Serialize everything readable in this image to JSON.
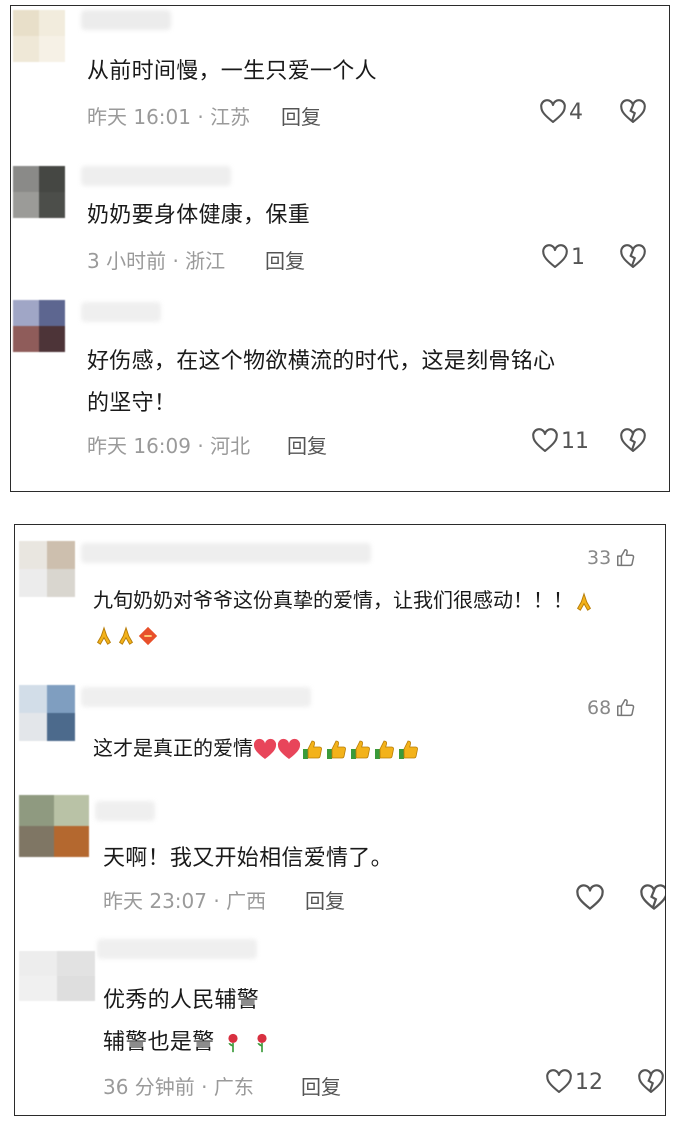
{
  "panel1": {
    "comments": [
      {
        "text": "从前时间慢，一生只爱一个人",
        "meta": "昨天 16:01 · 江苏",
        "reply": "回复",
        "likes": "4"
      },
      {
        "text": "奶奶要身体健康，保重",
        "meta": "3 小时前 · 浙江",
        "reply": "回复",
        "likes": "1"
      },
      {
        "text_line1": "好伤感，在这个物欲横流的时代，这是刻骨铭心",
        "text_line2": "的坚守！",
        "meta": "昨天 16:09 · 河北",
        "reply": "回复",
        "likes": "11"
      }
    ]
  },
  "panel2": {
    "comments": [
      {
        "likes": "33",
        "text_line1": "九旬奶奶对爷爷这份真挚的爱情，让我们很感动！！！"
      },
      {
        "likes": "68",
        "text": "这才是真正的爱情"
      },
      {
        "text": "天啊！我又开始相信爱情了。",
        "meta": "昨天 23:07 · 广西",
        "reply": "回复"
      },
      {
        "text_line1": "优秀的人民辅警",
        "text_line2": "辅警也是警",
        "meta": "36 分钟前 · 广东",
        "reply": "回复",
        "likes": "12"
      }
    ]
  },
  "icons": {
    "heart": "heart-outline-icon",
    "broken_heart": "broken-heart-icon",
    "thumbs_up": "thumbs-up-outline-icon",
    "pray": "pray-emoji",
    "red_heart": "red-heart-emoji",
    "thumbs_emoji": "thumbs-up-emoji",
    "rose": "rose-emoji",
    "diamond": "red-diamond-emoji"
  },
  "colors": {
    "meta": "#9a9a9a",
    "text": "#1a1a1a",
    "emoji_red": "#e8455a",
    "emoji_yellow": "#f3b21a"
  }
}
